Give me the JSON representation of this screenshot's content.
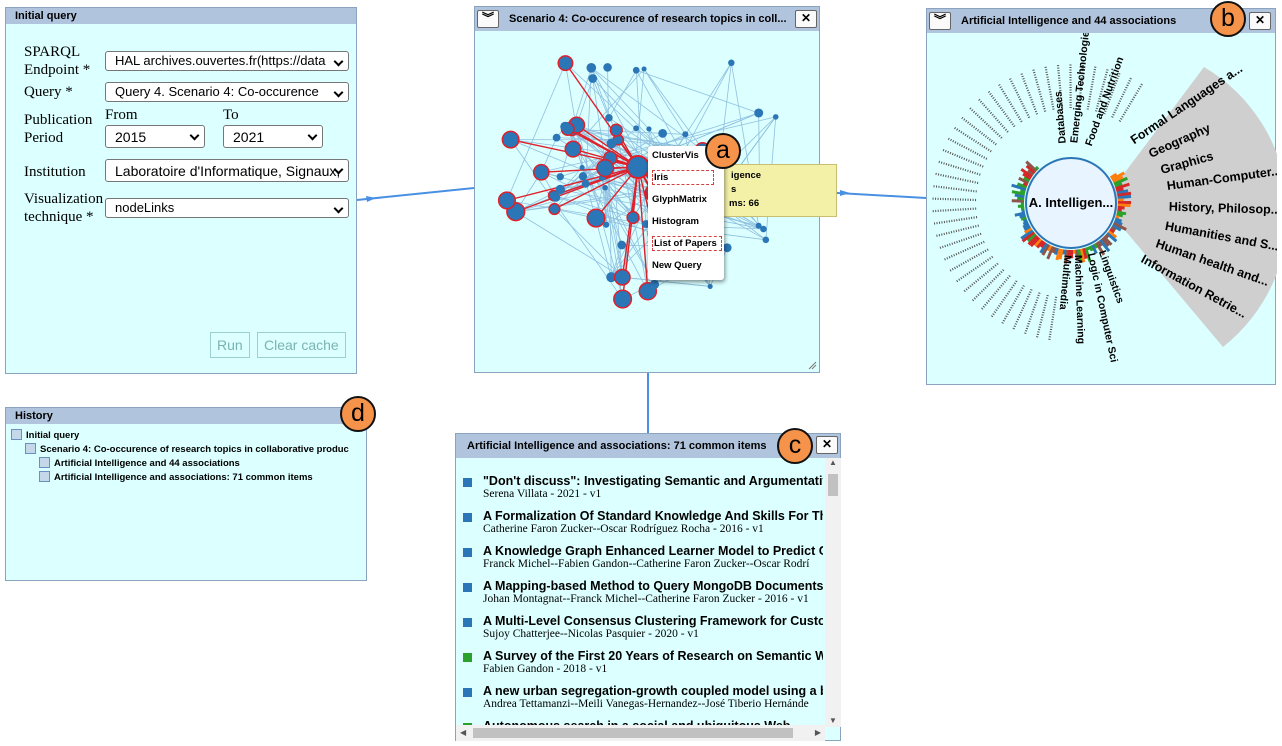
{
  "initial_query": {
    "title": "Initial query",
    "endpoint_label": "SPARQL Endpoint *",
    "endpoint_value": "HAL archives.ouvertes.fr(https://data",
    "query_label": "Query *",
    "query_value": "Query 4. Scenario 4: Co-occurence",
    "period_label": "Publication Period",
    "from_label": "From",
    "from_value": "2015",
    "to_label": "To",
    "to_value": "2021",
    "institution_label": "Institution",
    "institution_value": "Laboratoire d'Informatique, Signaux,",
    "viz_label": "Visualization technique *",
    "viz_value": "nodeLinks",
    "run_label": "Run",
    "clear_label": "Clear cache"
  },
  "scenario": {
    "title": "Scenario 4: Co-occurence of research topics in coll...",
    "menu": [
      "ClusterVis",
      "Iris",
      "GlyphMatrix",
      "Histogram",
      "List of Papers",
      "New Query"
    ],
    "tooltip_lines": [
      "igence",
      "s",
      "ms: 66"
    ]
  },
  "ai_panel": {
    "title": "Artificial Intelligence and 44 associations",
    "center_label": "A. Intelligen...",
    "fan_labels": [
      "Formal Languages a...",
      "Geography",
      "Graphics",
      "Human-Computer...",
      "History, Philosop...",
      "Humanities and S...",
      "Human health and...",
      "Information Retrie..."
    ],
    "outer_labels_top": [
      "Food and Nutrition",
      "Emerging Technologie",
      "Databases"
    ],
    "outer_labels_bottom": [
      "Linguistics",
      "Logic in Computer Sci",
      "Machine Learning",
      "Multimedia"
    ]
  },
  "history": {
    "title": "History",
    "items": [
      "Initial query",
      "Scenario 4: Co-occurence of research topics in collaborative produc",
      "Artificial Intelligence and 44 associations",
      "Artificial Intelligence and associations: 71 common items"
    ]
  },
  "common_items": {
    "title": "Artificial Intelligence and associations: 71 common items",
    "papers": [
      {
        "title": "\"Don't discuss\": Investigating Semantic and Argumentative",
        "authors": "Serena Villata - 2021 - v1",
        "color": "#2b76b6"
      },
      {
        "title": "A Formalization Of Standard Knowledge And Skills For The",
        "authors": "Catherine Faron Zucker--Oscar Rodríguez Rocha - 2016 - v1",
        "color": "#2b76b6"
      },
      {
        "title": "A Knowledge Graph Enhanced Learner Model to Predict Out",
        "authors": "Franck Michel--Fabien Gandon--Catherine Faron Zucker--Oscar Rodrí",
        "color": "#2b76b6"
      },
      {
        "title": "A Mapping-based Method to Query MongoDB Documents w",
        "authors": "Johan Montagnat--Franck Michel--Catherine Faron Zucker - 2016 - v1",
        "color": "#2b76b6"
      },
      {
        "title": "A Multi-Level Consensus Clustering Framework for Custome",
        "authors": "Sujoy Chatterjee--Nicolas Pasquier - 2020 - v1",
        "color": "#2b76b6"
      },
      {
        "title": "A Survey of the First 20 Years of Research on Semantic Web",
        "authors": "Fabien Gandon - 2018 - v1",
        "color": "#2ca02c"
      },
      {
        "title": "A new urban segregation-growth coupled model using a bel",
        "authors": "Andrea Tettamanzi--Meili Vanegas-Hernandez--José Tiberio Hernánde",
        "color": "#2b76b6"
      },
      {
        "title": "Autonomous search in a social and ubiquitous Web",
        "authors": "",
        "color": "#2ca02c"
      }
    ]
  },
  "badges": {
    "a": "a",
    "b": "b",
    "c": "c",
    "d": "d"
  },
  "colors": {
    "panel_bg": "#dcffff",
    "title_bar": "#b0c4de",
    "node": "#2b76b6",
    "highlight": "#e0202a",
    "badge": "#f5934b"
  }
}
